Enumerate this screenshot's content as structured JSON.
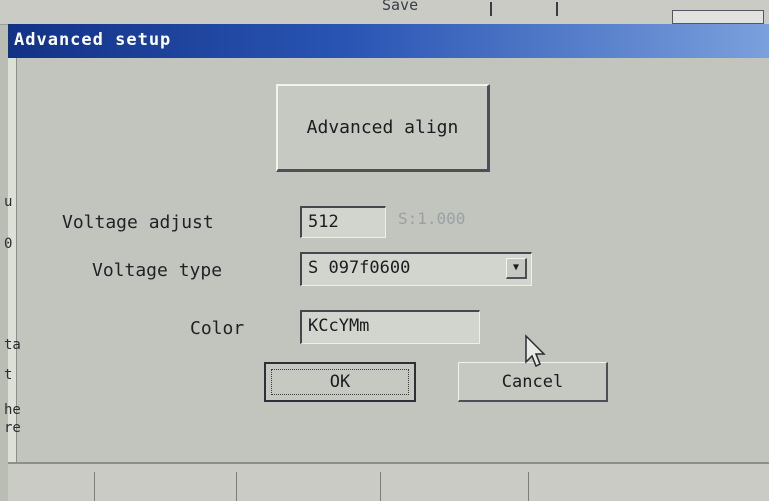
{
  "background": {
    "save_label": "Save"
  },
  "dialog": {
    "title": "Advanced setup",
    "advanced_align_label": "Advanced align",
    "voltage_adjust": {
      "label": "Voltage adjust",
      "value": "512",
      "scale_text": "S:1.000"
    },
    "voltage_type": {
      "label": "Voltage type",
      "selected": "S 097f0600"
    },
    "color": {
      "label": "Color",
      "value": "KCcYMm"
    },
    "ok_label": "OK",
    "cancel_label": "Cancel"
  },
  "left_edge_fragments": [
    "u",
    "0",
    "ta",
    "t",
    "he",
    "re"
  ],
  "colors": {
    "titlebar": "#123286",
    "dialog_bg": "#c2c5bd",
    "field_bg": "#d2d5cd"
  }
}
